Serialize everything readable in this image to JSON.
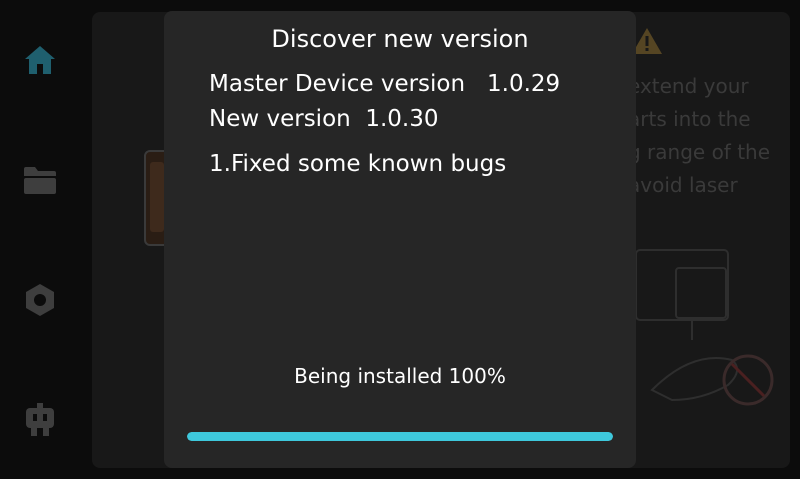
{
  "sidebar": {
    "items": [
      {
        "icon": "home-icon",
        "active": true
      },
      {
        "icon": "folder-icon",
        "active": false
      },
      {
        "icon": "settings-hex-icon",
        "active": false
      },
      {
        "icon": "robot-icon",
        "active": false
      }
    ]
  },
  "background_panel": {
    "warning_lines": [
      "extend your",
      "arts into the",
      "g range of the",
      "avoid laser"
    ]
  },
  "dialog": {
    "title": "Discover new version",
    "master_label": "Master Device version",
    "master_version": "1.0.29",
    "new_label": "New version",
    "new_version": "1.0.30",
    "changelog": "1.Fixed some known bugs",
    "status_text": "Being installed 100%",
    "progress_percent": 100
  },
  "colors": {
    "accent": "#3ec8dc",
    "nav_active": "#1f5f6e",
    "nav_inactive": "#3e3e3e",
    "warning": "#c89c3a"
  }
}
